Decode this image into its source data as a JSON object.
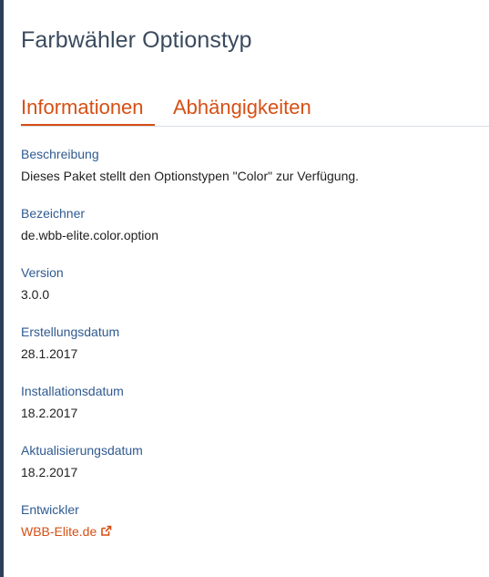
{
  "page": {
    "title": "Farbwähler Optionstyp"
  },
  "tabs": [
    {
      "label": "Informationen",
      "active": true
    },
    {
      "label": "Abhängigkeiten",
      "active": false
    }
  ],
  "fields": {
    "description": {
      "label": "Beschreibung",
      "value": "Dieses Paket stellt den Optionstypen \"Color\" zur Verfügung."
    },
    "identifier": {
      "label": "Bezeichner",
      "value": "de.wbb-elite.color.option"
    },
    "version": {
      "label": "Version",
      "value": "3.0.0"
    },
    "created": {
      "label": "Erstellungsdatum",
      "value": "28.1.2017"
    },
    "installed": {
      "label": "Installationsdatum",
      "value": "18.2.2017"
    },
    "updated": {
      "label": "Aktualisierungsdatum",
      "value": "18.2.2017"
    },
    "author": {
      "label": "Entwickler",
      "value": "WBB-Elite.de",
      "icon": "external-link-icon"
    }
  },
  "colors": {
    "accent": "#d64f14",
    "label": "#2f5a90",
    "title": "#3a4a5e",
    "sidebar": "#2c3e58"
  }
}
